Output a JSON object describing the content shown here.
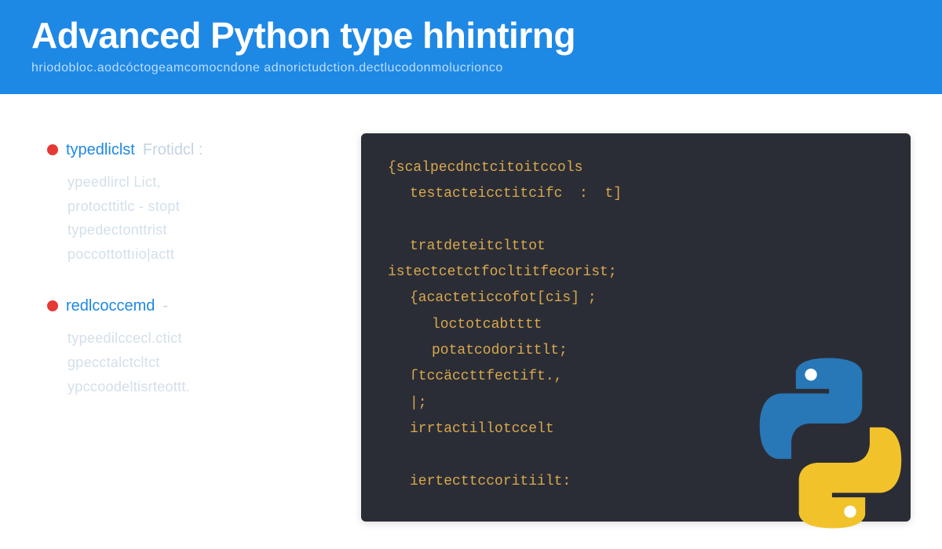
{
  "header": {
    "title": "Advanced Python type hhintirng",
    "subtitle": "hriodobloc.aodcóctogeamcomocndone adnorictudction.dectlucodonmolucrionco"
  },
  "left": {
    "groups": [
      {
        "term": "typedliclst",
        "suffix": "Frotidcl :",
        "lines": [
          "ypeedlircl Lict,",
          "protocttitlc  -  stopt",
          "typedectonttrist",
          "poccottottıio|actt"
        ]
      },
      {
        "term": "redlcoccemd",
        "suffix": "-",
        "lines": [
          "typeedilccecl.ctict",
          "gpecctalctcltct",
          "ypccoodeltisrteottt."
        ]
      }
    ]
  },
  "code": {
    "lines": [
      {
        "i": 0,
        "t": "{scalpecdnctcitoitccols"
      },
      {
        "i": 1,
        "t": "testacteicctitcifc  :  t]"
      },
      {
        "i": 0,
        "t": ""
      },
      {
        "i": 1,
        "t": "tratdeteitclttot"
      },
      {
        "i": 0,
        "t": "istectcetctfocltitfecorist;"
      },
      {
        "i": 1,
        "t": "{acacteticcofot[cis] ;"
      },
      {
        "i": 2,
        "t": "loctotcabtttt"
      },
      {
        "i": 2,
        "t": "potatcodorittlt;"
      },
      {
        "i": 1,
        "t": "ſtccäccttfectift.,"
      },
      {
        "i": 1,
        "t": "|;"
      },
      {
        "i": 1,
        "t": "irrtactillotccelt"
      },
      {
        "i": 0,
        "t": ""
      },
      {
        "i": 1,
        "t": "iertecttccoritiilt:"
      }
    ]
  },
  "logo": {
    "blue": "#2877b7",
    "yellow": "#f2c22a"
  }
}
